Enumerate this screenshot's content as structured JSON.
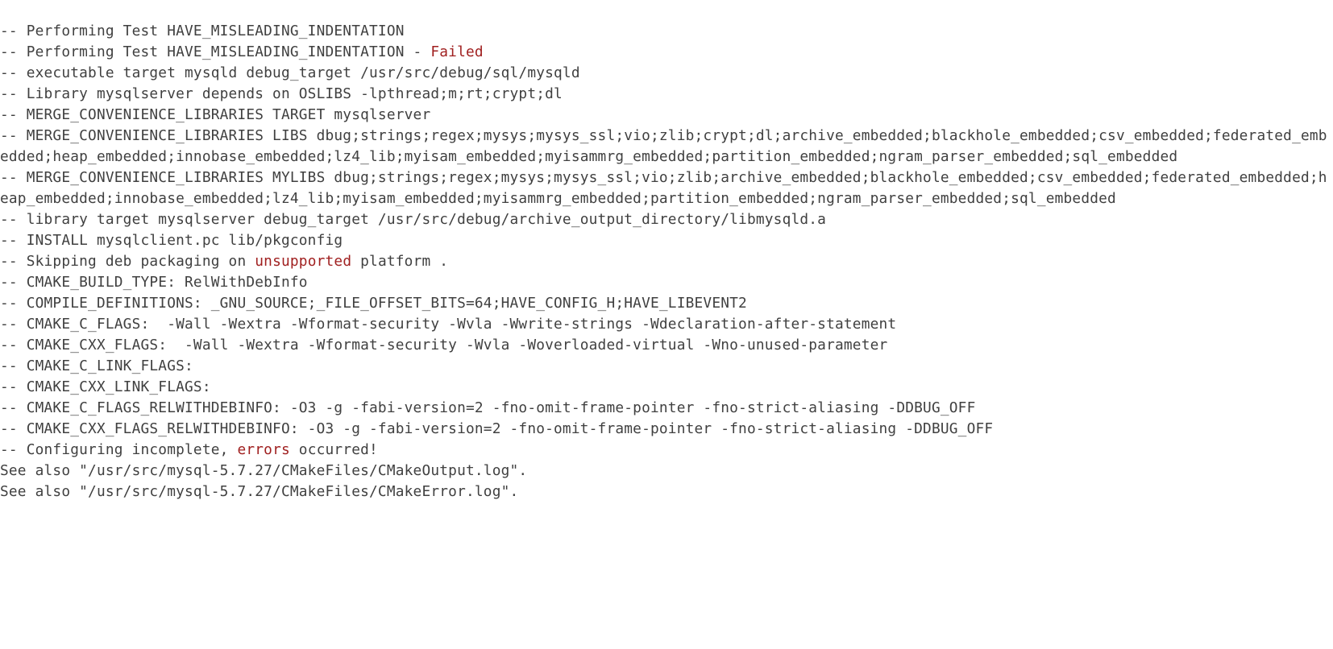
{
  "lines": [
    {
      "a": "-- Performing Test HAVE_MISLEADING_INDENTATION"
    },
    {
      "a": "-- Performing Test HAVE_MISLEADING_INDENTATION - ",
      "b": "Failed"
    },
    {
      "a": "-- executable target mysqld debug_target /usr/src/debug/sql/mysqld"
    },
    {
      "a": "-- Library mysqlserver depends on OSLIBS -lpthread;m;rt;crypt;dl"
    },
    {
      "a": "-- MERGE_CONVENIENCE_LIBRARIES TARGET mysqlserver"
    },
    {
      "a": "-- MERGE_CONVENIENCE_LIBRARIES LIBS dbug;strings;regex;mysys;mysys_ssl;vio;zlib;crypt;dl;archive_embedded;blackhole_embedded;csv_embedded;federated_embedded;heap_embedded;innobase_embedded;lz4_lib;myisam_embedded;myisammrg_embedded;partition_embedded;ngram_parser_embedded;sql_embedded"
    },
    {
      "a": "-- MERGE_CONVENIENCE_LIBRARIES MYLIBS dbug;strings;regex;mysys;mysys_ssl;vio;zlib;archive_embedded;blackhole_embedded;csv_embedded;federated_embedded;heap_embedded;innobase_embedded;lz4_lib;myisam_embedded;myisammrg_embedded;partition_embedded;ngram_parser_embedded;sql_embedded"
    },
    {
      "a": "-- library target mysqlserver debug_target /usr/src/debug/archive_output_directory/libmysqld.a"
    },
    {
      "a": "-- INSTALL mysqlclient.pc lib/pkgconfig"
    },
    {
      "a": "-- Skipping deb packaging on ",
      "b": "unsupported",
      "c": " platform ."
    },
    {
      "a": "-- CMAKE_BUILD_TYPE: RelWithDebInfo"
    },
    {
      "a": "-- COMPILE_DEFINITIONS: _GNU_SOURCE;_FILE_OFFSET_BITS=64;HAVE_CONFIG_H;HAVE_LIBEVENT2"
    },
    {
      "a": "-- CMAKE_C_FLAGS:  -Wall -Wextra -Wformat-security -Wvla -Wwrite-strings -Wdeclaration-after-statement"
    },
    {
      "a": "-- CMAKE_CXX_FLAGS:  -Wall -Wextra -Wformat-security -Wvla -Woverloaded-virtual -Wno-unused-parameter"
    },
    {
      "a": "-- CMAKE_C_LINK_FLAGS:"
    },
    {
      "a": "-- CMAKE_CXX_LINK_FLAGS:"
    },
    {
      "a": "-- CMAKE_C_FLAGS_RELWITHDEBINFO: -O3 -g -fabi-version=2 -fno-omit-frame-pointer -fno-strict-aliasing -DDBUG_OFF"
    },
    {
      "a": "-- CMAKE_CXX_FLAGS_RELWITHDEBINFO: -O3 -g -fabi-version=2 -fno-omit-frame-pointer -fno-strict-aliasing -DDBUG_OFF"
    },
    {
      "a": "-- Configuring incomplete, ",
      "b": "errors",
      "c": " occurred!"
    },
    {
      "a": "See also \"/usr/src/mysql-5.7.27/CMakeFiles/CMakeOutput.log\"."
    },
    {
      "a": "See also \"/usr/src/mysql-5.7.27/CMakeFiles/CMakeError.log\"."
    }
  ]
}
